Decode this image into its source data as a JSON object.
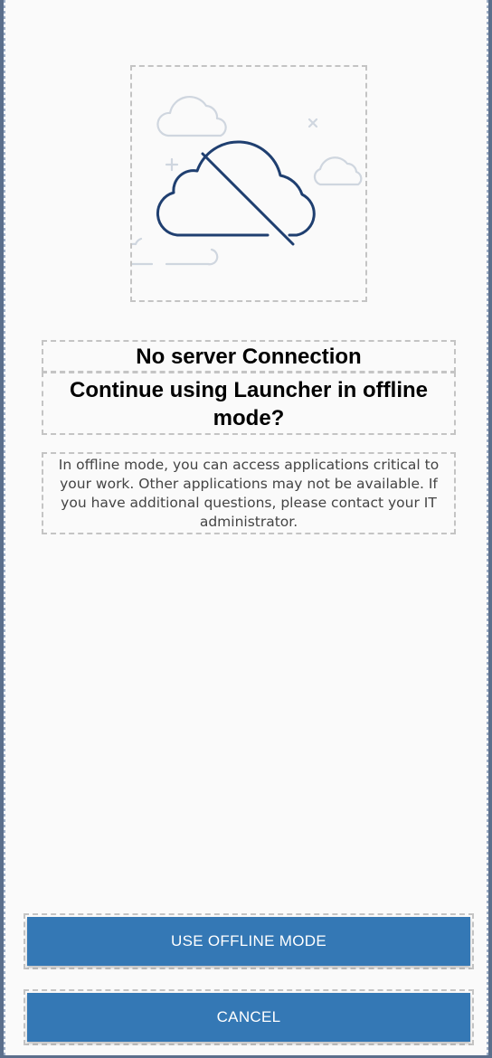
{
  "dialog": {
    "illustration_icon": "cloud-offline-icon",
    "title": "No server Connection",
    "subtitle": "Continue using Launcher in offline mode?",
    "message": "In offline mode, you can access applications critical to your work. Other applications may not be available. If you have additional questions, please contact your IT administrator."
  },
  "actions": {
    "offline_label": "USE OFFLINE MODE",
    "cancel_label": "CANCEL"
  },
  "colors": {
    "primary_button": "#3478b5",
    "icon_stroke": "#1f3f70",
    "decor_stroke": "#cfd6df"
  }
}
